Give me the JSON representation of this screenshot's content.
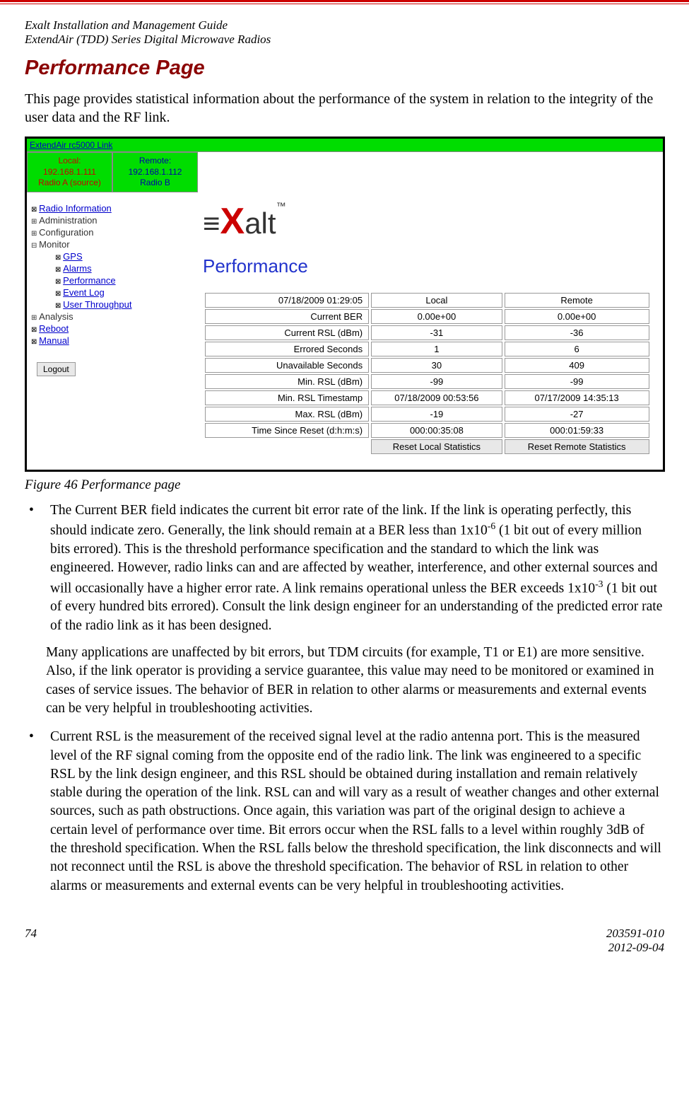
{
  "header": {
    "line1": "Exalt Installation and Management Guide",
    "line2": "ExtendAir (TDD) Series Digital Microwave Radios"
  },
  "title": "Performance Page",
  "intro": "This page provides statistical information about the performance of the system in relation to the integrity of the user data and the RF link.",
  "screenshot": {
    "link_name": "ExtendAir rc5000 Link",
    "local": {
      "label": "Local:",
      "ip": "192.168.1.111",
      "radio": "Radio A (source)"
    },
    "remote": {
      "label": "Remote:",
      "ip": "192.168.1.112",
      "radio": "Radio B"
    },
    "logo_text": "alt",
    "logo_tm": "™",
    "panel_title": "Performance",
    "nav": {
      "radio_info": "Radio Information",
      "admin": "Administration",
      "config": "Configuration",
      "monitor": "Monitor",
      "gps": "GPS",
      "alarms": "Alarms",
      "performance": "Performance",
      "event_log": "Event Log",
      "user_throughput": "User Throughput",
      "analysis": "Analysis",
      "reboot": "Reboot",
      "manual": "Manual",
      "logout": "Logout"
    },
    "table": {
      "timestamp": "07/18/2009 01:29:05",
      "col_local": "Local",
      "col_remote": "Remote",
      "rows": [
        {
          "label": "Current BER",
          "local": "0.00e+00",
          "remote": "0.00e+00"
        },
        {
          "label": "Current RSL (dBm)",
          "local": "-31",
          "remote": "-36"
        },
        {
          "label": "Errored Seconds",
          "local": "1",
          "remote": "6"
        },
        {
          "label": "Unavailable Seconds",
          "local": "30",
          "remote": "409"
        },
        {
          "label": "Min. RSL (dBm)",
          "local": "-99",
          "remote": "-99"
        },
        {
          "label": "Min. RSL Timestamp",
          "local": "07/18/2009 00:53:56",
          "remote": "07/17/2009 14:35:13"
        },
        {
          "label": "Max. RSL (dBm)",
          "local": "-19",
          "remote": "-27"
        },
        {
          "label": "Time Since Reset (d:h:m:s)",
          "local": "000:00:35:08",
          "remote": "000:01:59:33"
        }
      ],
      "reset_local": "Reset Local Statistics",
      "reset_remote": "Reset Remote Statistics"
    }
  },
  "caption": "Figure 46   Performance page",
  "bullets": {
    "b1a": "The Current BER field indicates the current bit error rate of the link. If the link is operating perfectly, this should indicate zero. Generally, the link should remain at a BER less than 1x10",
    "b1b": " (1 bit out of every million bits errored). This is the threshold performance specification and the standard to which the link was engineered. However, radio links can and are affected by weather, interference, and other external sources and will occasionally have a higher error rate. A link remains operational unless the BER exceeds 1x10",
    "b1c": " (1 bit out of every hundred bits errored). Consult the link design engineer for an understanding of the predicted error rate of the radio link as it has been designed.",
    "b1sup1": "-6",
    "b1sup2": "-3",
    "b1p2": "Many applications are unaffected by bit errors, but TDM circuits (for example, T1 or E1) are more sensitive. Also, if the link operator is providing a service guarantee, this value may need to be monitored or examined in cases of service issues. The behavior of BER in relation to other alarms or measurements and external events can be very helpful in troubleshooting activities.",
    "b2": "Current RSL is the measurement of the received signal level at the radio antenna port. This is the measured level of the RF signal coming from the opposite end of the radio link. The link was engineered to a specific RSL by the link design engineer, and this RSL should be obtained during installation and remain relatively stable during the operation of the link. RSL can and will vary as a result of weather changes and other external sources, such as path obstructions. Once again, this variation was part of the original design to achieve a certain level of performance over time. Bit errors occur when the RSL falls to a level within roughly 3dB of the threshold specification. When the RSL falls below the threshold specification, the link disconnects and will not reconnect until the RSL is above the threshold specification. The behavior of RSL in relation to other alarms or measurements and external events can be very helpful in troubleshooting activities."
  },
  "footer": {
    "page": "74",
    "doc": "203591-010",
    "date": "2012-09-04"
  }
}
